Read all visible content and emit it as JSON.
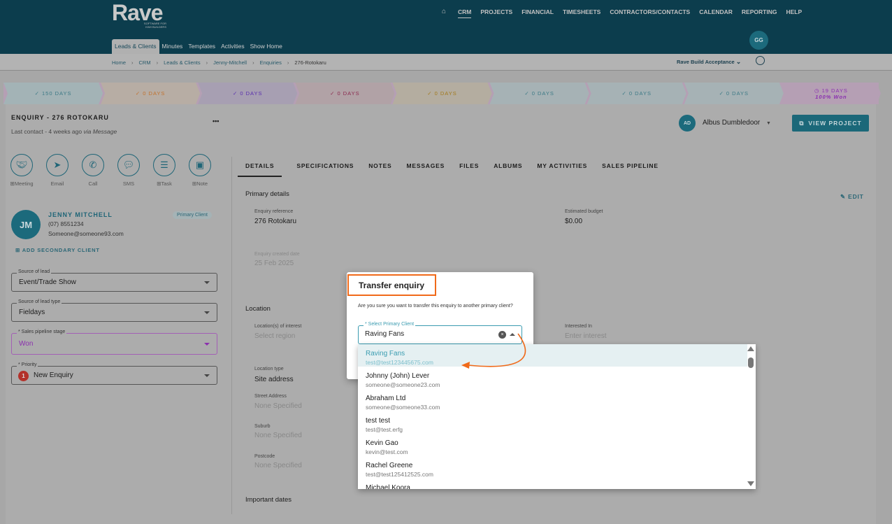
{
  "brand": {
    "name": "Rave",
    "tagline": "SOFTWARE FOR KIWI BUILDERS"
  },
  "topnav": [
    "CRM",
    "PROJECTS",
    "FINANCIAL",
    "TIMESHEETS",
    "CONTRACTORS/CONTACTS",
    "CALENDAR",
    "REPORTING",
    "HELP"
  ],
  "user_initials": "GG",
  "subnav": [
    "Leads & Clients",
    "Minutes",
    "Templates",
    "Activities",
    "Show Home"
  ],
  "breadcrumb": [
    "Home",
    "CRM",
    "Leads & Clients",
    "Jenny-Mitchell",
    "Enquiries",
    "276-Rotokaru"
  ],
  "company": "Rave Build Acceptance",
  "stages": [
    {
      "label": "✓ 150 DAYS",
      "color": "#3d7a86",
      "bg": "#a3b3b6"
    },
    {
      "label": "✓ 0 DAYS",
      "color": "#c2722d",
      "bg": "#b7ada4"
    },
    {
      "label": "✓ 0 DAYS",
      "color": "#5a2fae",
      "bg": "#a79fb2"
    },
    {
      "label": "✓ 0 DAYS",
      "color": "#8b2b4f",
      "bg": "#b1a2a6"
    },
    {
      "label": "✓ 0 DAYS",
      "color": "#a27a1c",
      "bg": "#b4ada0"
    },
    {
      "label": "✓ 0 DAYS",
      "color": "#3d7a86",
      "bg": "#a6b2b5"
    },
    {
      "label": "✓ 0 DAYS",
      "color": "#3d7a86",
      "bg": "#a6b2b5"
    },
    {
      "label": "✓ 0 DAYS",
      "color": "#3d7a86",
      "bg": "#a6b2b5"
    },
    {
      "label": "◷ 19 DAYS",
      "sub": "100% Won",
      "color": "#8a2fb0",
      "bg": "#b59fb4"
    }
  ],
  "enquiry": {
    "title": "ENQUIRY - 276 ROTOKARU",
    "last_contact": "Last contact - 4 weeks ago",
    "via": "via Message",
    "more": "•••"
  },
  "assignee": {
    "initials": "AD",
    "name": "Albus Dumbledoor"
  },
  "view_project": "VIEW PROJECT",
  "actions": [
    {
      "label": "Meeting",
      "icon": "handshake-icon"
    },
    {
      "label": "Email",
      "icon": "send-icon"
    },
    {
      "label": "Call",
      "icon": "phone-icon"
    },
    {
      "label": "SMS",
      "icon": "chat-icon"
    },
    {
      "label": "Task",
      "icon": "checklist-icon"
    },
    {
      "label": "Note",
      "icon": "note-icon"
    }
  ],
  "client": {
    "initials": "JM",
    "name": "JENNY MITCHELL",
    "phone": "(07) 8551234",
    "email": "Someone@someone93.com",
    "badge": "Primary Client",
    "add_secondary": "ADD SECONDARY CLIENT"
  },
  "fields": [
    {
      "label": "Source of lead",
      "value": "Event/Trade Show"
    },
    {
      "label": "Source of lead type",
      "value": "Fieldays"
    },
    {
      "label": "* Sales pipeline stage",
      "value": "Won"
    },
    {
      "label": "* Priority",
      "value": "New Enquiry",
      "badge": "1"
    }
  ],
  "tabs": [
    "DETAILS",
    "SPECIFICATIONS",
    "NOTES",
    "MESSAGES",
    "FILES",
    "ALBUMS",
    "MY ACTIVITIES",
    "SALES PIPELINE"
  ],
  "details": {
    "primary": "Primary details",
    "edit": "EDIT",
    "ref_label": "Enquiry reference",
    "ref": "276 Rotokaru",
    "budget_label": "Estimated budget",
    "budget": "$0.00",
    "created_label": "Enquiry created date",
    "created": "25 Feb 2025",
    "location": "Location",
    "loi_label": "Location(s) of interest",
    "loi": "Select region",
    "int_label": "Interested In",
    "int": "Enter interest",
    "loctype_label": "Location type",
    "loctype": "Site address",
    "street_label": "Street Address",
    "street": "None Specified",
    "suburb_label": "Suburb",
    "suburb": "None Specified",
    "post_label": "Postcode",
    "post": "None Specified",
    "important": "Important dates"
  },
  "dialog": {
    "title": "Transfer enquiry",
    "message": "Are you sure you want to transfer this enquiry to another primary client?",
    "select_label": "* Select Primary Client",
    "select_value": "Raving Fans",
    "options": [
      {
        "name": "Raving Fans",
        "email": "test@test123445675.com"
      },
      {
        "name": "Johnny (John) Lever",
        "email": "someone@someone23.com"
      },
      {
        "name": "Abraham Ltd",
        "email": "someone@someone33.com"
      },
      {
        "name": "test test",
        "email": "test@test.erfg"
      },
      {
        "name": "Kevin Gao",
        "email": "kevin@test.com"
      },
      {
        "name": "Rachel Greene",
        "email": "test@test125412525.com"
      },
      {
        "name": "Michael Koora",
        "email": ""
      }
    ]
  }
}
